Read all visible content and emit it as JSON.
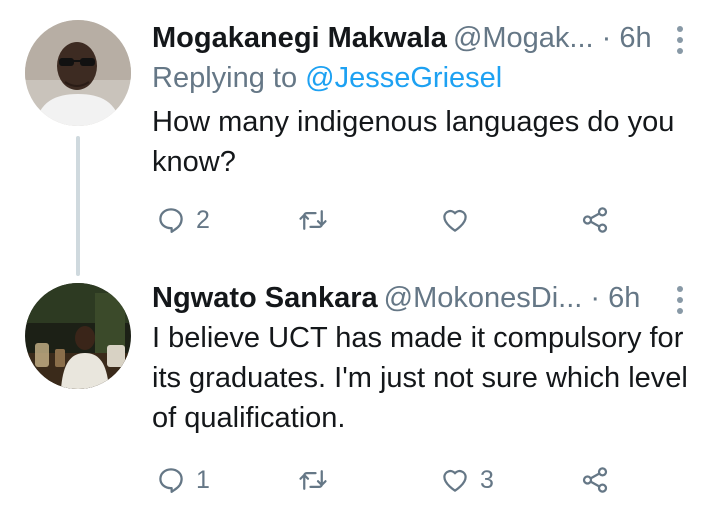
{
  "tweets": [
    {
      "author_name": "Mogakanegi Makwala",
      "handle": "@Mogak...",
      "dot": "·",
      "time": "6h",
      "replying_prefix": "Replying to",
      "replying_to": "@JesseGriesel",
      "text": "How many indigenous languages do you know?",
      "reply_count": "2",
      "retweet_count": "",
      "like_count": ""
    },
    {
      "author_name": "Ngwato Sankara",
      "handle": "@MokonesDi...",
      "dot": "·",
      "time": "6h",
      "text": "I believe UCT has made it compulsory for its graduates. I'm just not sure which level of qualification.",
      "reply_count": "1",
      "retweet_count": "",
      "like_count": "3"
    }
  ],
  "colors": {
    "text": "#14171a",
    "secondary": "#657786",
    "accent": "#1da1f2",
    "thread_line": "#cfd9de"
  },
  "icons": [
    "reply-icon",
    "retweet-icon",
    "like-icon",
    "share-icon",
    "more-options-icon"
  ]
}
